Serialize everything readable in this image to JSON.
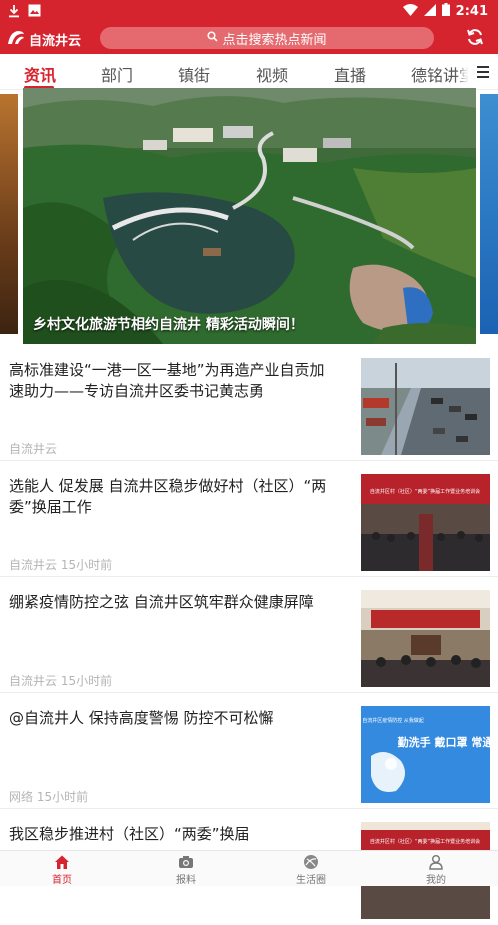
{
  "status_bar": {
    "time": "2:41",
    "icons": [
      "download-icon",
      "gallery-icon",
      "wifi-icon",
      "signal-icon",
      "battery-icon"
    ]
  },
  "app_bar": {
    "logo_text": "自流井云",
    "search_placeholder": "点击搜索热点新闻",
    "refresh_icon": "refresh-icon"
  },
  "tabs": [
    {
      "label": "资讯",
      "active": true
    },
    {
      "label": "部门",
      "active": false
    },
    {
      "label": "镇街",
      "active": false
    },
    {
      "label": "视频",
      "active": false
    },
    {
      "label": "直播",
      "active": false
    },
    {
      "label": "德铭讲堂",
      "active": false
    }
  ],
  "banner": {
    "caption": "乡村文化旅游节相约自流井 精彩活动瞬间！"
  },
  "news": [
    {
      "title": "高标准建设“一港一区一基地”为再造产业自贡加速助力——专访自流井区委书记黄志勇",
      "meta": "自流井云"
    },
    {
      "title": "选能人 促发展 自流井区稳步做好村（社区）“两委”换届工作",
      "meta": "自流井云 15小时前"
    },
    {
      "title": "绷紧疫情防控之弦 自流井区筑牢群众健康屏障",
      "meta": "自流井云 15小时前"
    },
    {
      "title": "@自流井人 保持高度警惕 防控不可松懈",
      "meta": "网络  15小时前"
    },
    {
      "title": "我区稳步推进村（社区）“两委”换届",
      "meta": ""
    }
  ],
  "thumb_text": {
    "meeting_banner_1": "自流井区村（社区）“两委”换届工作暨业务培训会",
    "meeting_banner_2": "自流井区村（社区）“两委”换届工作暨业务培训会",
    "poster_small": "自流井区疫情防控 从我做起",
    "poster_big": "勤洗手 戴口罩 常通风"
  },
  "bottom_nav": [
    {
      "label": "首页",
      "icon": "home-icon",
      "active": true
    },
    {
      "label": "报料",
      "icon": "camera-icon",
      "active": false
    },
    {
      "label": "生活圈",
      "icon": "circle-icon",
      "active": false
    },
    {
      "label": "我的",
      "icon": "user-icon",
      "active": false
    }
  ],
  "colors": {
    "brand_red": "#d6242f",
    "search_bg": "#e46a6f",
    "meta_gray": "#b5b5b5"
  }
}
